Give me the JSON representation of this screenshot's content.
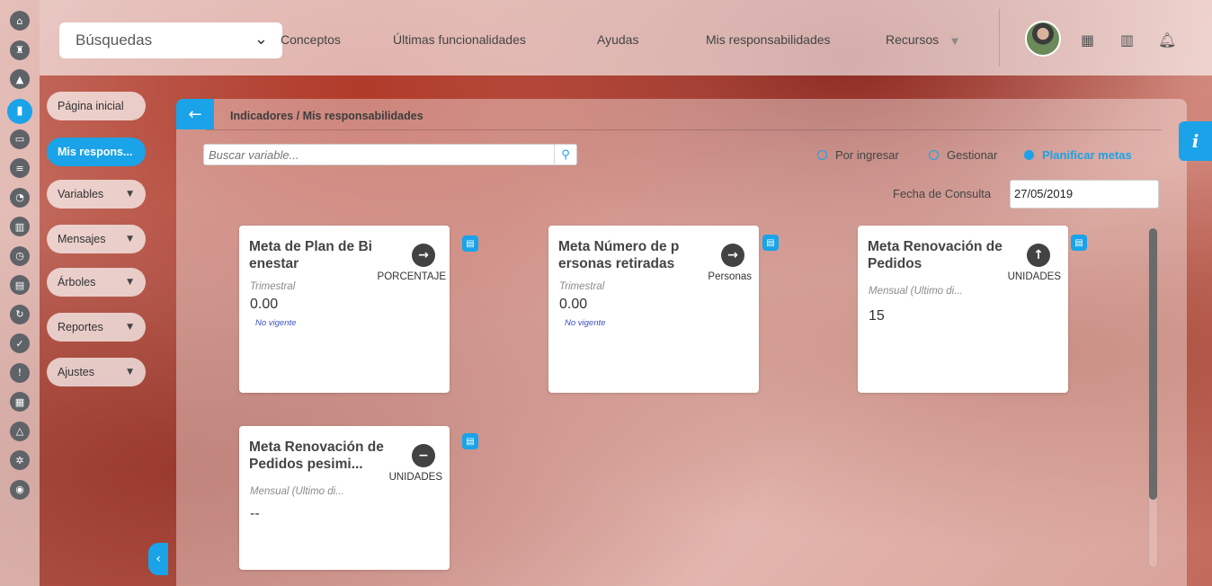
{
  "topbar": {
    "search_combo_label": "Búsquedas",
    "nav": [
      {
        "label": "Conceptos"
      },
      {
        "label": "Últimas funcionalidades"
      },
      {
        "label": "Ayudas"
      },
      {
        "label": "Mis responsabilidades"
      },
      {
        "label": "Recursos"
      }
    ]
  },
  "left_menu": {
    "items": [
      {
        "label": "Página inicial"
      },
      {
        "label": "Mis respons..."
      },
      {
        "label": "Variables"
      },
      {
        "label": "Mensajes"
      },
      {
        "label": "Árboles"
      },
      {
        "label": "Reportes"
      },
      {
        "label": "Ajustes"
      }
    ]
  },
  "panel": {
    "breadcrumb": "Indicadores / Mis responsabilidades",
    "search_placeholder": "Buscar variable...",
    "radios": [
      {
        "label": "Por ingresar",
        "selected": false
      },
      {
        "label": "Gestionar",
        "selected": false
      },
      {
        "label": "Planificar metas",
        "selected": true
      }
    ],
    "date_label": "Fecha de Consulta",
    "date_value": "27/05/2019",
    "cards": [
      {
        "title": "Meta de Plan de Bi enestar",
        "trend": "right",
        "unit": "PORCENTAJE",
        "period": "Trimestral",
        "value": "0.00",
        "status": "No vigente"
      },
      {
        "title": "Meta Número de p ersonas retiradas",
        "trend": "right",
        "unit": "Personas",
        "period": "Trimestral",
        "value": "0.00",
        "status": "No vigente"
      },
      {
        "title": "Meta  Renovación de Pedidos",
        "trend": "up",
        "unit": "UNIDADES",
        "period": "Mensual (Ultimo di...",
        "value": "15",
        "status": ""
      },
      {
        "title": "Meta  Renovación de Pedidos pesimi...",
        "trend": "neutral",
        "unit": "UNIDADES",
        "period": "Mensual (Ultimo di...",
        "value": "--",
        "status": ""
      }
    ]
  },
  "colors": {
    "accent": "#1aa3e8",
    "status_link": "#3b4fc7",
    "icon_dark": "#424242"
  },
  "icons": {
    "rail": [
      "home-icon",
      "tower-icon",
      "up-triangle-icon",
      "chart-icon",
      "monitor-icon",
      "lines-icon",
      "pie-icon",
      "book-icon",
      "clock-icon",
      "document-icon",
      "cycle-icon",
      "check-icon",
      "warning-icon",
      "calendar-icon",
      "network-icon",
      "gear-icon",
      "database-icon"
    ],
    "trend_right": "arrow-right-icon",
    "trend_up": "arrow-up-icon",
    "trend_neutral": "minus-icon",
    "comment": "comment-icon",
    "info": "info-icon"
  }
}
